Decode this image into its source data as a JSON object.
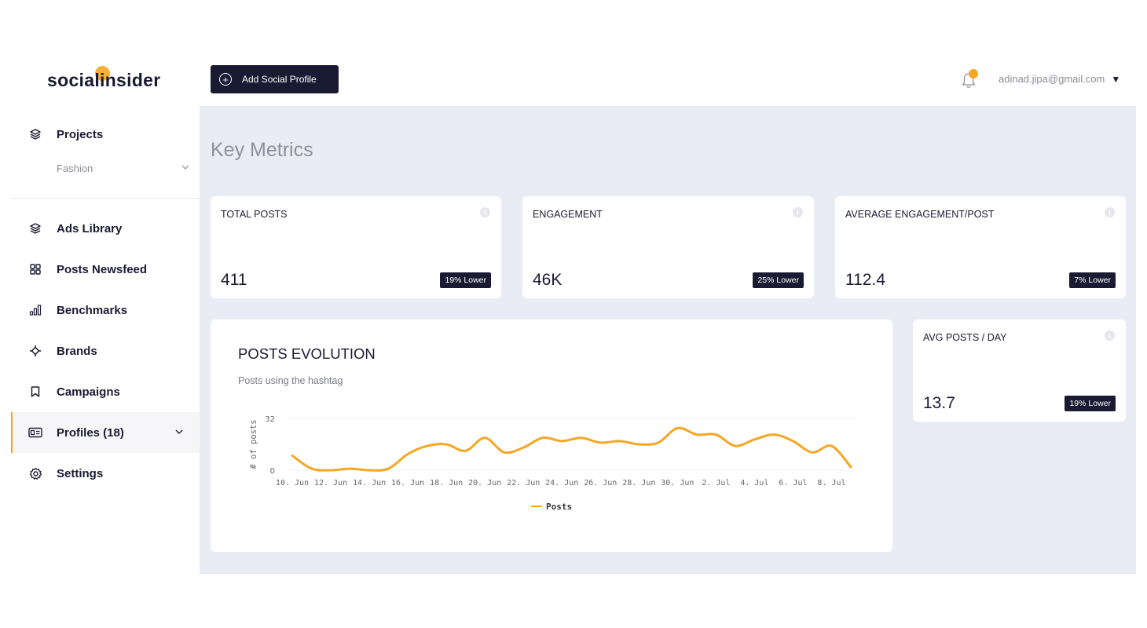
{
  "brand": {
    "logo_text": "socialinsider"
  },
  "sidebar": {
    "projects_label": "Projects",
    "project_selected": "Fashion",
    "items": [
      {
        "label": "Ads Library",
        "icon": "layers-icon"
      },
      {
        "label": "Posts Newsfeed",
        "icon": "grid-icon"
      },
      {
        "label": "Benchmarks",
        "icon": "bar-chart-icon"
      },
      {
        "label": "Brands",
        "icon": "crosshair-icon"
      },
      {
        "label": "Campaigns",
        "icon": "bookmark-icon"
      },
      {
        "label": "Profiles (18)",
        "icon": "profile-card-icon"
      },
      {
        "label": "Settings",
        "icon": "gear-icon"
      }
    ]
  },
  "topbar": {
    "add_button_label": "Add Social Profile",
    "user_email": "adinad.jipa@gmail.com"
  },
  "main": {
    "section_title": "Key Metrics",
    "metrics": [
      {
        "title": "TOTAL POSTS",
        "value": "411",
        "badge": "19% Lower"
      },
      {
        "title": "ENGAGEMENT",
        "value": "46K",
        "badge": "25% Lower"
      },
      {
        "title": "AVERAGE ENGAGEMENT/POST",
        "value": "112.4",
        "badge": "7% Lower"
      },
      {
        "title": "AVG POSTS / DAY",
        "value": "13.7",
        "badge": "19% Lower"
      }
    ],
    "chart_card": {
      "title": "POSTS EVOLUTION",
      "subtitle": "Posts using the hashtag"
    }
  },
  "colors": {
    "accent": "#f5a623",
    "dark": "#1b1a33",
    "background": "#e9ecf4"
  },
  "chart_data": {
    "type": "line",
    "ylabel": "# of posts",
    "ylim": [
      0,
      32
    ],
    "yticks": [
      "0",
      "32"
    ],
    "xticks": [
      "10. Jun",
      "12. Jun",
      "14. Jun",
      "16. Jun",
      "18. Jun",
      "20. Jun",
      "22. Jun",
      "24. Jun",
      "26. Jun",
      "28. Jun",
      "30. Jun",
      "2. Jul",
      "4. Jul",
      "6. Jul",
      "8. Jul"
    ],
    "series": [
      {
        "name": "Posts",
        "color": "#f5a623",
        "x": [
          "10. Jun",
          "11. Jun",
          "12. Jun",
          "13. Jun",
          "14. Jun",
          "15. Jun",
          "16. Jun",
          "17. Jun",
          "18. Jun",
          "19. Jun",
          "20. Jun",
          "21. Jun",
          "22. Jun",
          "23. Jun",
          "24. Jun",
          "25. Jun",
          "26. Jun",
          "27. Jun",
          "28. Jun",
          "29. Jun",
          "30. Jun",
          "1. Jul",
          "2. Jul",
          "3. Jul",
          "4. Jul",
          "5. Jul",
          "6. Jul",
          "7. Jul",
          "8. Jul",
          "9. Jul"
        ],
        "values": [
          9,
          1,
          0,
          1,
          0,
          1,
          10,
          15,
          16,
          12,
          20,
          11,
          14,
          20,
          18,
          20,
          17,
          18,
          16,
          17,
          26,
          22,
          22,
          15,
          19,
          22,
          18,
          11,
          15,
          2
        ]
      }
    ]
  }
}
